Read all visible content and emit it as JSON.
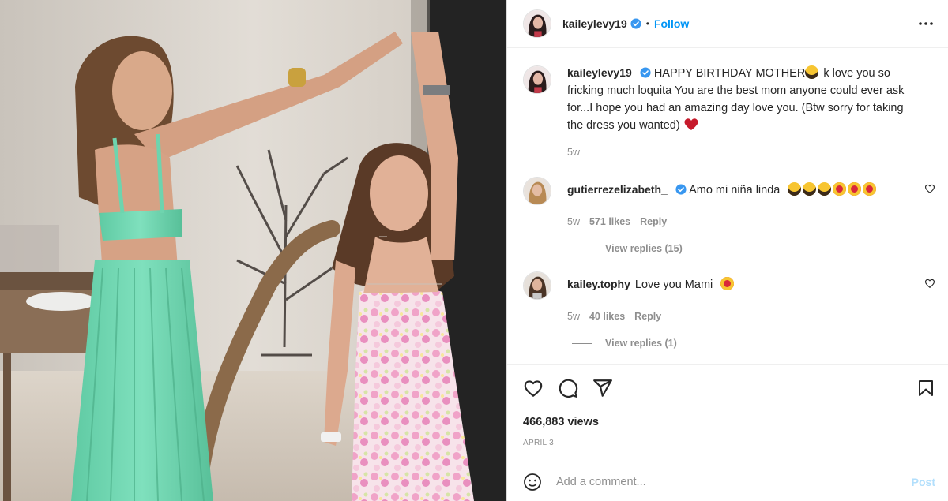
{
  "header": {
    "username": "kaileylevy19",
    "separator": "•",
    "follow_label": "Follow"
  },
  "caption": {
    "username": "kaileylevy19",
    "text_part1": "HAPPY BIRTHDAY MOTHER",
    "text_part2": " k love you so fricking much loquita You are the best mom anyone could ever ask for...I hope you had an amazing day love you. (Btw sorry for taking the dress you wanted) ",
    "age": "5w"
  },
  "comments": [
    {
      "username": "gutierrezelizabeth_",
      "text": "Amo mi niña linda",
      "age": "5w",
      "likes": "571 likes",
      "reply_label": "Reply",
      "view_replies": "View replies (15)"
    },
    {
      "username": "kailey.tophy",
      "text": "Love you Mami",
      "age": "5w",
      "likes": "40 likes",
      "reply_label": "Reply",
      "view_replies": "View replies (1)"
    }
  ],
  "stats": {
    "views": "466,883 views",
    "date": "APRIL 3"
  },
  "composer": {
    "placeholder": "Add a comment...",
    "post_label": "Post"
  },
  "colors": {
    "accent": "#0095f6",
    "post_disabled": "#b2dffc",
    "muted": "#8e8e8e"
  },
  "icons": [
    "verified-badge-icon",
    "more-options-icon",
    "heart-icon",
    "comment-icon",
    "share-icon",
    "bookmark-icon",
    "emoji-icon"
  ]
}
